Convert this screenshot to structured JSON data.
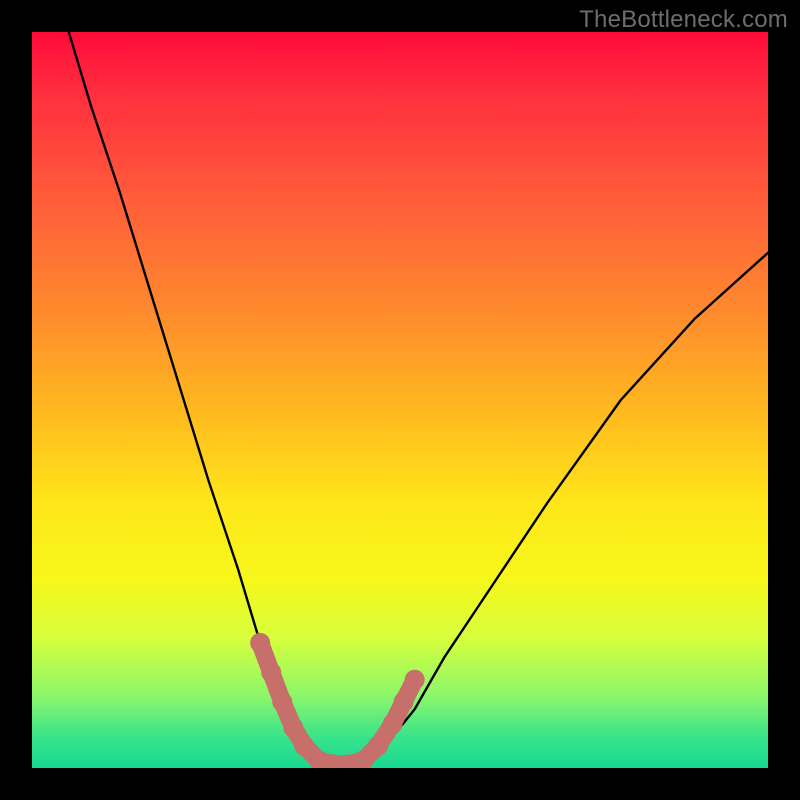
{
  "watermark": "TheBottleneck.com",
  "colors": {
    "frame": "#000000",
    "curve": "#000000",
    "markers": "#c76f6a",
    "gradient_stops": [
      "#ff0b3a",
      "#ff2d3f",
      "#ff5a3a",
      "#ff8a2e",
      "#ffbb1e",
      "#ffe61a",
      "#f7f71a",
      "#d9ff3a",
      "#8ef76a",
      "#36e38c",
      "#18d890"
    ]
  },
  "chart_data": {
    "type": "line",
    "title": "",
    "xlabel": "",
    "ylabel": "",
    "xlim": [
      0,
      100
    ],
    "ylim": [
      0,
      100
    ],
    "grid": false,
    "legend": false,
    "series": [
      {
        "name": "bottleneck-curve",
        "x": [
          5,
          8,
          12,
          16,
          20,
          24,
          28,
          31,
          33,
          35,
          37,
          39,
          41,
          43,
          45,
          48,
          52,
          56,
          62,
          70,
          80,
          90,
          100
        ],
        "y": [
          100,
          90,
          78,
          65,
          52,
          39,
          27,
          17,
          11,
          6,
          3,
          1,
          0,
          0,
          1,
          3,
          8,
          15,
          24,
          36,
          50,
          61,
          70
        ]
      }
    ],
    "markers": {
      "name": "highlight-zone",
      "color": "#c76f6a",
      "points": [
        {
          "x": 31,
          "y": 17
        },
        {
          "x": 32.5,
          "y": 13
        },
        {
          "x": 34,
          "y": 9
        },
        {
          "x": 35.5,
          "y": 5.5
        },
        {
          "x": 37,
          "y": 3
        },
        {
          "x": 39,
          "y": 1
        },
        {
          "x": 41,
          "y": 0.5
        },
        {
          "x": 43,
          "y": 0.5
        },
        {
          "x": 45,
          "y": 1
        },
        {
          "x": 47,
          "y": 3
        },
        {
          "x": 49,
          "y": 6
        },
        {
          "x": 50.5,
          "y": 9
        },
        {
          "x": 52,
          "y": 12
        }
      ]
    }
  }
}
